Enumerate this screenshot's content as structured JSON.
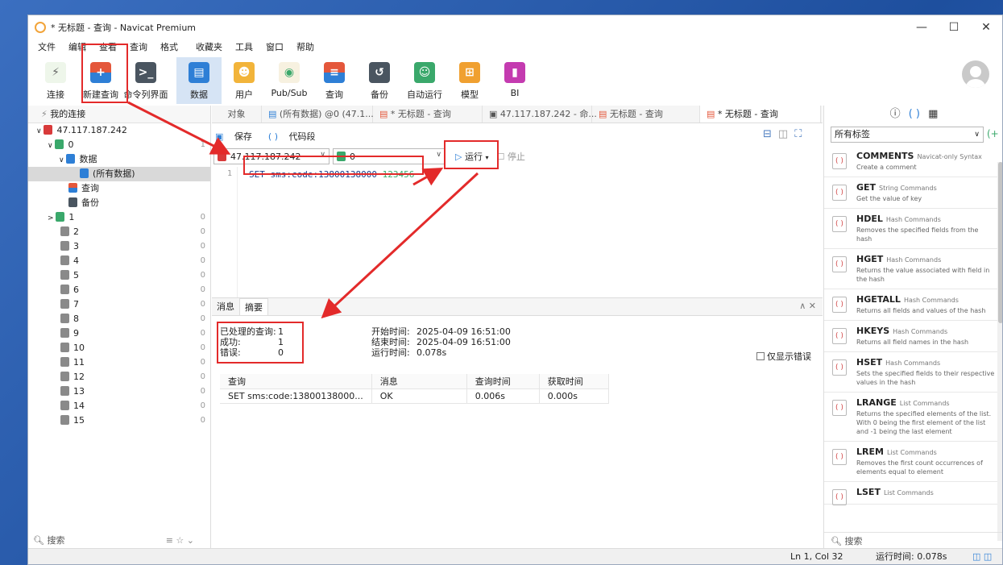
{
  "window": {
    "title": "* 无标题 - 查询 - Navicat Premium",
    "controls": [
      "—",
      "☐",
      "✕"
    ]
  },
  "menu": [
    "文件",
    "编辑",
    "查看",
    "查询",
    "格式",
    "收藏夹",
    "工具",
    "窗口",
    "帮助"
  ],
  "toolbar": {
    "connect": "连接",
    "new_query": "新建查询",
    "cli": "命令列界面",
    "data": "数据",
    "user": "用户",
    "pubsub": "Pub/Sub",
    "query": "查询",
    "backup": "备份",
    "automation": "自动运行",
    "model": "模型",
    "bi": "BI"
  },
  "connections": {
    "header": "我的连接",
    "host": "47.117.187.242",
    "db0": "0",
    "db0_count": "1",
    "data_folder": "数据",
    "all_data": "(所有数据)",
    "query_folder": "查询",
    "backup_folder": "备份",
    "dbs": [
      {
        "name": "1",
        "count": "0"
      },
      {
        "name": "2",
        "count": "0"
      },
      {
        "name": "3",
        "count": "0"
      },
      {
        "name": "4",
        "count": "0"
      },
      {
        "name": "5",
        "count": "0"
      },
      {
        "name": "6",
        "count": "0"
      },
      {
        "name": "7",
        "count": "0"
      },
      {
        "name": "8",
        "count": "0"
      },
      {
        "name": "9",
        "count": "0"
      },
      {
        "name": "10",
        "count": "0"
      },
      {
        "name": "11",
        "count": "0"
      },
      {
        "name": "12",
        "count": "0"
      },
      {
        "name": "13",
        "count": "0"
      },
      {
        "name": "14",
        "count": "0"
      },
      {
        "name": "15",
        "count": "0"
      }
    ],
    "search": "搜索"
  },
  "tabs": [
    "对象",
    "(所有数据) @0 (47.1...",
    "* 无标题 - 查询",
    "47.117.187.242 - 命...",
    "无标题 - 查询",
    "* 无标题 - 查询"
  ],
  "query_toolbar": {
    "save": "保存",
    "snippet": "代码段"
  },
  "selectors": {
    "connection": "47.117.187.242",
    "database": "0",
    "run": "运行",
    "stop": "停止"
  },
  "editor": {
    "line": "1",
    "code_kw": "SET sms:code:13800138000",
    "code_num": "123456"
  },
  "result": {
    "tabs": [
      "消息",
      "摘要"
    ],
    "processed_label": "已处理的查询:",
    "processed": "1",
    "success_label": "成功:",
    "success": "1",
    "error_label": "错误:",
    "error": "0",
    "start_label": "开始时间:",
    "start": "2025-04-09 16:51:00",
    "end_label": "结束时间:",
    "end": "2025-04-09 16:51:00",
    "elapsed_label": "运行时间:",
    "elapsed": "0.078s",
    "only_errors": "仅显示错误",
    "columns": [
      "查询",
      "消息",
      "查询时间",
      "获取时间"
    ],
    "row": [
      "SET sms:code:13800138000...",
      "OK",
      "0.006s",
      "0.000s"
    ]
  },
  "snippet_panel": {
    "filter": "所有标签",
    "items": [
      {
        "name": "COMMENTS",
        "cat": "Navicat-only Syntax",
        "desc": "Create a comment"
      },
      {
        "name": "GET",
        "cat": "String Commands",
        "desc": "Get the value of key"
      },
      {
        "name": "HDEL",
        "cat": "Hash Commands",
        "desc": "Removes the specified fields from the hash"
      },
      {
        "name": "HGET",
        "cat": "Hash Commands",
        "desc": "Returns the value associated with field in the hash"
      },
      {
        "name": "HGETALL",
        "cat": "Hash Commands",
        "desc": "Returns all fields and values of the hash"
      },
      {
        "name": "HKEYS",
        "cat": "Hash Commands",
        "desc": "Returns all field names in the hash"
      },
      {
        "name": "HSET",
        "cat": "Hash Commands",
        "desc": "Sets the specified fields to their respective values in the hash"
      },
      {
        "name": "LRANGE",
        "cat": "List Commands",
        "desc": "Returns the specified elements of the list. With 0 being the first element of the list and -1 being the last element"
      },
      {
        "name": "LREM",
        "cat": "List Commands",
        "desc": "Removes the first count occurrences of elements equal to element"
      },
      {
        "name": "LSET",
        "cat": "List Commands",
        "desc": ""
      }
    ],
    "search": "搜索"
  },
  "status": {
    "position": "Ln 1, Col 32",
    "elapsed": "运行时间: 0.078s"
  },
  "colors": {
    "accent": "#2f6fd1",
    "annotation": "#e32a2a",
    "redis": "#d83a3a",
    "db": "#3aa86b"
  }
}
